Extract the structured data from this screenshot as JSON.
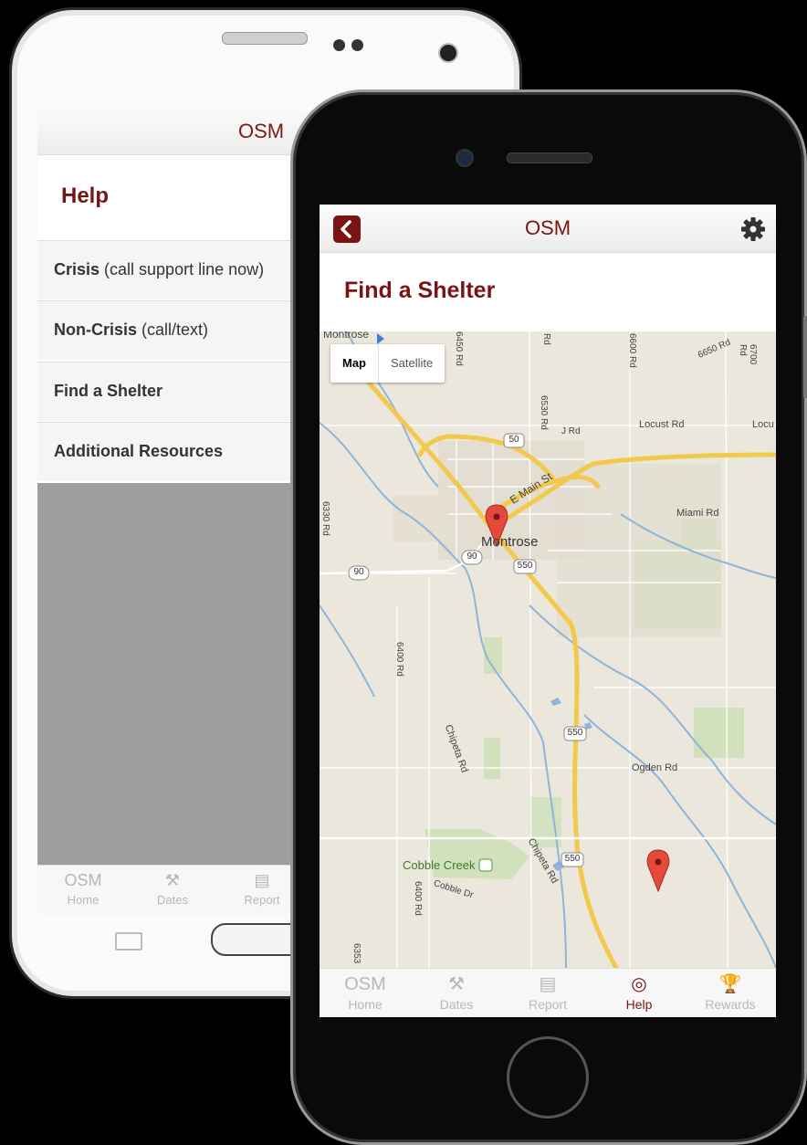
{
  "android": {
    "app_title": "OSM",
    "page_title": "Help",
    "menu": [
      {
        "bold": "Crisis",
        "rest": " (call support line now)"
      },
      {
        "bold": "Non-Crisis",
        "rest": " (call/text)"
      },
      {
        "bold": "Find a Shelter",
        "rest": ""
      },
      {
        "bold": "Additional Resources",
        "rest": ""
      }
    ],
    "tabs": [
      {
        "icon_text": "OSM",
        "label": "Home",
        "icon": "osm-logo"
      },
      {
        "icon_text": "⚒",
        "label": "Dates",
        "icon": "gavel-icon"
      },
      {
        "icon_text": "▤",
        "label": "Report",
        "icon": "document-icon"
      }
    ]
  },
  "iphone": {
    "app_title": "OSM",
    "page_title": "Find a Shelter",
    "map": {
      "toggle": {
        "map": "Map",
        "satellite": "Satellite"
      },
      "labels": {
        "montrose_top": "Montrose",
        "montrose": "Montrose",
        "e_main_st": "E Main St",
        "locust_rd": "Locust Rd",
        "locust_cut": "Locu",
        "miami_rd": "Miami Rd",
        "ogden_rd": "Ogden Rd",
        "chipeta_rd": "Chipeta Rd",
        "chipeta_rd2": "Chipeta Rd",
        "cobble_creek": "Cobble Creek",
        "cobble_dr": "Cobble Dr",
        "j_rd": "J Rd",
        "rd_6530": "6530 Rd",
        "rd_6600": "6600 Rd",
        "rd_6650": "6650 Rd",
        "rd_6700": "6700 Rd",
        "rd_6400a": "6400 Rd",
        "rd_6400b": "6400 Rd",
        "rd_6330": "6330 Rd",
        "rd_6450": "6450 Rd",
        "rd_6353": "6353",
        "rd_top_mid": "Rd",
        "hw_50": "50",
        "hw_90a": "90",
        "hw_90b": "90",
        "hw_550a": "550",
        "hw_550b": "550",
        "hw_550c": "550"
      }
    },
    "tabs": [
      {
        "icon_text": "OSM",
        "label": "Home",
        "icon": "osm-logo"
      },
      {
        "icon_text": "⚒",
        "label": "Dates",
        "icon": "gavel-icon"
      },
      {
        "icon_text": "▤",
        "label": "Report",
        "icon": "document-icon"
      },
      {
        "icon_text": "◎",
        "label": "Help",
        "icon": "lifebuoy-icon",
        "active": true
      },
      {
        "icon_text": "🏆",
        "label": "Rewards",
        "icon": "trophy-icon"
      }
    ]
  },
  "colors": {
    "brand": "#7a1414",
    "tab_inactive": "#b8b8b8",
    "map_bg": "#ece7dc",
    "road": "#f5cf5a"
  }
}
